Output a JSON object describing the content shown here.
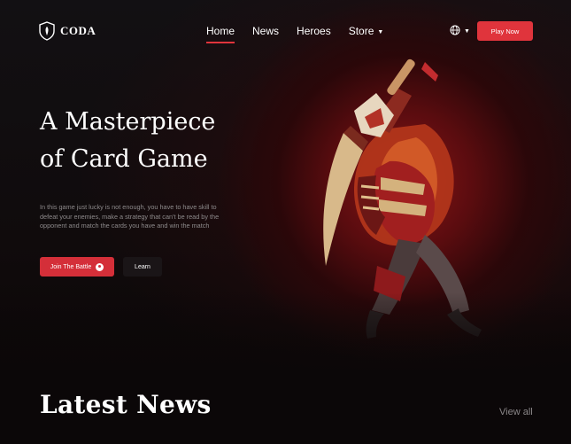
{
  "brand": {
    "name": "CODA",
    "accent": "#e0343c"
  },
  "nav": {
    "items": [
      {
        "label": "Home",
        "active": true
      },
      {
        "label": "News",
        "active": false
      },
      {
        "label": "Heroes",
        "active": false
      },
      {
        "label": "Store",
        "active": false,
        "has_dropdown": true
      }
    ],
    "language_icon": "globe-icon",
    "play_button": "Play Now"
  },
  "hero": {
    "title": "A Masterpiece\nof Card Game",
    "description": "In this game just lucky is not enough, you have to have skill to defeat your enemies, make a strategy that can't be read by the opponent and match the cards you have and win the match",
    "primary_button": "Join The Battle",
    "primary_button_icon": "steam-icon",
    "secondary_button": "Learn",
    "image": "samurai-warrior-illustration"
  },
  "news": {
    "title": "Latest News",
    "view_all": "View all"
  }
}
